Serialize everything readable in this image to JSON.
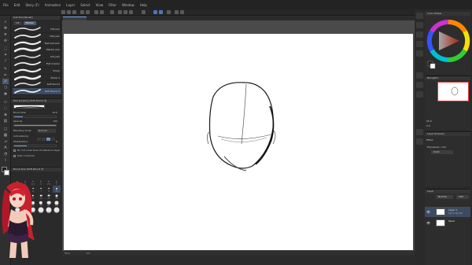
{
  "menu": [
    "File",
    "Edit",
    "Story (F)",
    "Animation",
    "Layer",
    "Select",
    "View",
    "Filter",
    "Window",
    "Help"
  ],
  "subtool": {
    "header": "Sub Tool [Brush]",
    "tabs": [
      "Ink",
      "Marker"
    ],
    "brushes": [
      {
        "label": "Mill pen",
        "selected": false
      },
      {
        "label": "Fast pen",
        "selected": false
      },
      {
        "label": "Textured pen",
        "selected": false
      },
      {
        "label": "Marker pen",
        "selected": false
      },
      {
        "label": "Dot pen",
        "selected": false
      },
      {
        "label": "Flat marker",
        "selected": false
      },
      {
        "label": "Sharp",
        "selected": false
      },
      {
        "label": "Sharp 2",
        "selected": false
      },
      {
        "label": "Soft Round",
        "selected": false
      },
      {
        "label": "Soft Round 2",
        "selected": true
      }
    ]
  },
  "tool_property": {
    "header": "Tool property [Soft Round 2]",
    "brush_size_label": "Brush Size",
    "brush_size_value": "10.0",
    "opacity_label": "Opacity",
    "opacity_value": "100",
    "opacity_fraction": 1.0,
    "blending_label": "Blending mode",
    "blending_value": "Normal",
    "antialiasing_label": "Anti-aliasing",
    "stabilization_label": "Stabilization",
    "stabilization_value": "6",
    "stabilization_fraction": 0.3,
    "option1": "Do not cross lines of reference layer",
    "option2": "Post correction"
  },
  "brush_size_panel": {
    "header": "Brush Size [Soft Round 2]",
    "sizes": [
      "0.7",
      "1",
      "1.5",
      "2",
      "2.5",
      "3",
      "4",
      "5",
      "6",
      "7",
      "8",
      "10",
      "12",
      "15",
      "17",
      "20",
      "25",
      "30",
      "40",
      "50",
      "60",
      "70",
      "80",
      "100",
      "120",
      "150",
      "170",
      "200",
      "250",
      "300"
    ],
    "selected_index": 11
  },
  "color_panel": {
    "header": "Color Wheel",
    "current_color": "#1f1f1f",
    "sub_color": "#ffffff"
  },
  "navigator": {
    "header": "Navigator",
    "zoom": "50.0",
    "rotation": "0.0"
  },
  "layer_property": {
    "header": "Layer Property",
    "effect_label": "Effect",
    "expression_label": "Expression color",
    "expression_value": "Color"
  },
  "layers": {
    "header": "Layer",
    "blend_mode": "Normal",
    "opacity": "100",
    "items": [
      {
        "name": "Layer 1",
        "sub": "100 % Normal",
        "selected": true
      },
      {
        "name": "Paper",
        "sub": "",
        "selected": false
      }
    ]
  },
  "status": {
    "zoom": "50.0",
    "rotation": "0.0"
  },
  "colors": {
    "accent": "#4a78b8",
    "selected_row": "#3c4b62",
    "panel_bg": "#2a2a2a"
  }
}
